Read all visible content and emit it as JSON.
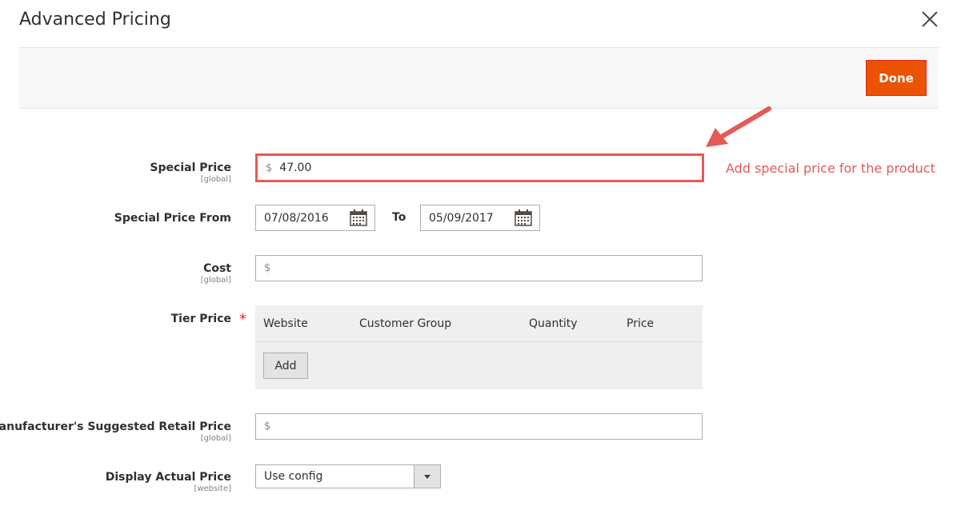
{
  "modal": {
    "title": "Advanced Pricing",
    "done_label": "Done"
  },
  "colors": {
    "accent": "#eb5202",
    "annotation": "#e45a57",
    "required": "#e22626"
  },
  "fields": {
    "special_price": {
      "label": "Special Price",
      "scope": "[global]",
      "prefix": "$",
      "value": "47.00"
    },
    "special_price_from": {
      "label": "Special Price From",
      "from_value": "07/08/2016",
      "to_label": "To",
      "to_value": "05/09/2017"
    },
    "cost": {
      "label": "Cost",
      "scope": "[global]",
      "prefix": "$",
      "value": ""
    },
    "tier_price": {
      "label": "Tier Price",
      "required_mark": "*",
      "columns": [
        "Website",
        "Customer Group",
        "Quantity",
        "Price"
      ],
      "add_label": "Add"
    },
    "msrp": {
      "label": "Manufacturer's Suggested Retail Price",
      "scope": "[global]",
      "prefix": "$",
      "value": ""
    },
    "display_actual_price": {
      "label": "Display Actual Price",
      "scope": "[website]",
      "selected": "Use config"
    }
  },
  "annotation": {
    "text": "Add special price for the product"
  },
  "icons": {
    "close": "close-icon",
    "calendar": "calendar-icon",
    "dropdown": "chevron-down-icon"
  }
}
